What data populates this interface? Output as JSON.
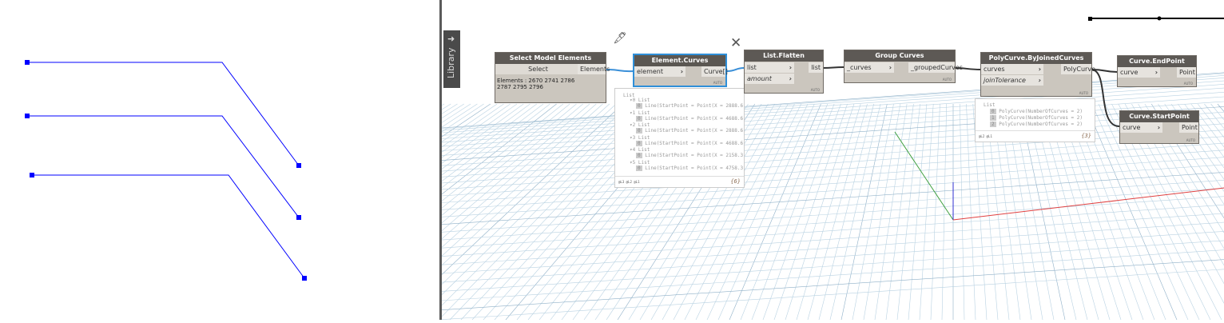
{
  "library_label": "Library",
  "nodes": {
    "select": {
      "title": "Select Model Elements",
      "button": "Select",
      "output": "Elements",
      "info": "Elements : 2670 2741 2786 2787 2795 2796"
    },
    "element_curves": {
      "title": "Element.Curves",
      "input": "element",
      "output": "Curve[]",
      "lacing": "AUTO"
    },
    "list_flatten": {
      "title": "List.Flatten",
      "inputs": [
        "list",
        "amount"
      ],
      "output": "list",
      "lacing": "AUTO"
    },
    "group_curves": {
      "title": "Group Curves",
      "input": "_curves",
      "output": "_groupedCurves",
      "lacing": "AUTO"
    },
    "polycurve": {
      "title": "PolyCurve.ByJoinedCurves",
      "inputs": [
        "curves",
        "joinTolerance"
      ],
      "output": "PolyCurve",
      "lacing": "AUTO"
    },
    "endpoint": {
      "title": "Curve.EndPoint",
      "input": "curve",
      "output": "Point",
      "lacing": "AUTO"
    },
    "startpoint": {
      "title": "Curve.StartPoint",
      "input": "curve",
      "output": "Point",
      "lacing": "AUTO"
    }
  },
  "preview1": {
    "root": "List",
    "items": [
      {
        "i": "0",
        "label": "List",
        "line": "Line(StartPoint = Point(X = 2888.6"
      },
      {
        "i": "1",
        "label": "List",
        "line": "Line(StartPoint = Point(X = 4688.6"
      },
      {
        "i": "2",
        "label": "List",
        "line": "Line(StartPoint = Point(X = 2888.6"
      },
      {
        "i": "3",
        "label": "List",
        "line": "Line(StartPoint = Point(X = 4688.6"
      },
      {
        "i": "4",
        "label": "List",
        "line": "Line(StartPoint = Point(X = 2158.3"
      },
      {
        "i": "5",
        "label": "List",
        "line": "Line(StartPoint = Point(X = 4758.3"
      }
    ],
    "levels": "@L3 @L2 @L1",
    "count": "{6}",
    "sub_index": "0"
  },
  "preview2": {
    "root": "List",
    "items": [
      {
        "i": "0",
        "line": "PolyCurve(NumberOfCurves = 2)"
      },
      {
        "i": "1",
        "line": "PolyCurve(NumberOfCurves = 2)"
      },
      {
        "i": "2",
        "line": "PolyCurve(NumberOfCurves = 2)"
      }
    ],
    "levels": "@L2 @L1",
    "count": "{3}"
  },
  "colors": {
    "line_blue": "#0000ff",
    "selected": "#2f8fd8",
    "x_axis": "#e04040",
    "y_axis": "#40a040",
    "z_axis": "#3030d0"
  }
}
